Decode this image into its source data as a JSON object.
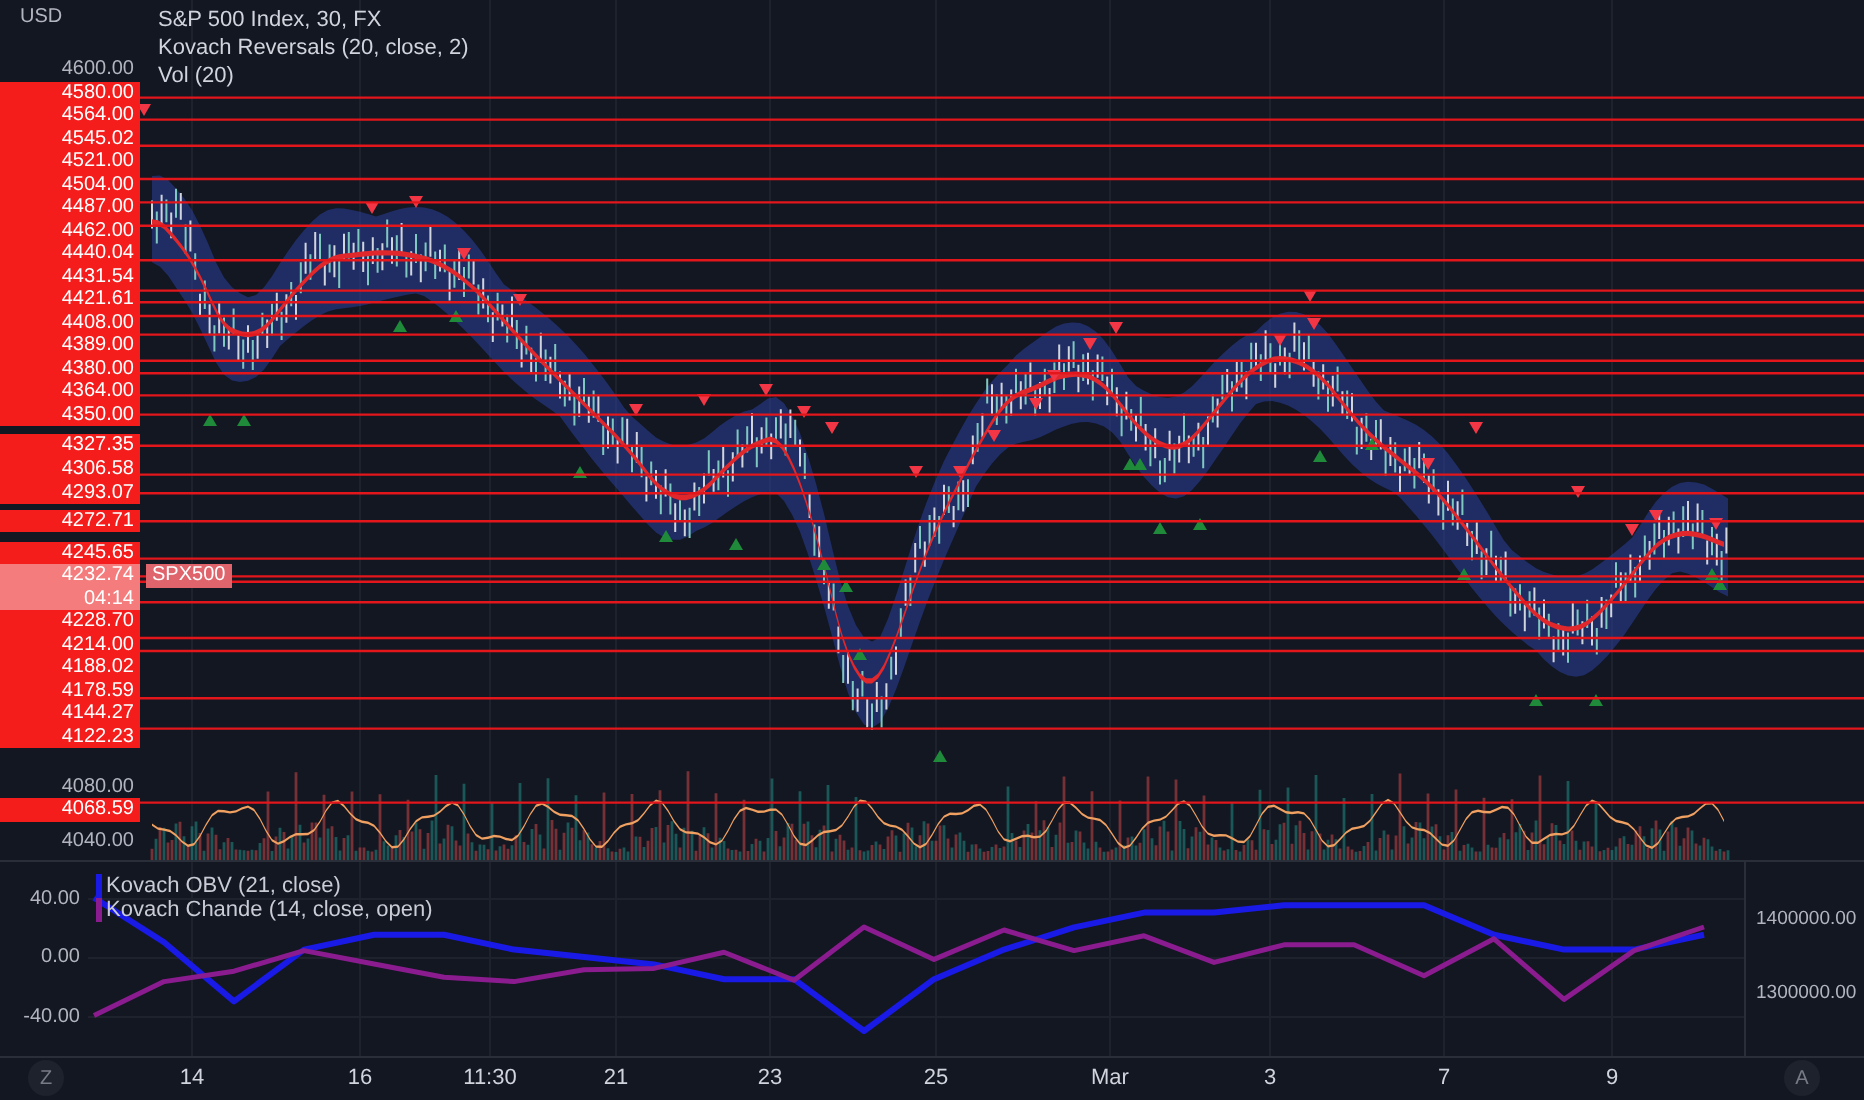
{
  "main_pane": {
    "currency": "USD",
    "legend": [
      "S&P 500 Index, 30, FX",
      "Kovach Reversals (20, close, 2)",
      "Vol (20)"
    ],
    "price_labels": [
      {
        "kind": "tick",
        "text": "4600.00"
      },
      {
        "kind": "level",
        "text": "4580.00"
      },
      {
        "kind": "level",
        "text": "4564.00"
      },
      {
        "kind": "level",
        "text": "4545.02"
      },
      {
        "kind": "level",
        "text": "4521.00"
      },
      {
        "kind": "level",
        "text": "4504.00"
      },
      {
        "kind": "level",
        "text": "4487.00"
      },
      {
        "kind": "level",
        "text": "4462.00"
      },
      {
        "kind": "level",
        "text": "4440.04"
      },
      {
        "kind": "level",
        "text": "4431.54"
      },
      {
        "kind": "level",
        "text": "4421.61"
      },
      {
        "kind": "level",
        "text": "4408.00"
      },
      {
        "kind": "level",
        "text": "4389.00"
      },
      {
        "kind": "level",
        "text": "4380.00"
      },
      {
        "kind": "level",
        "text": "4364.00"
      },
      {
        "kind": "level",
        "text": "4350.00"
      },
      {
        "kind": "level",
        "text": "4327.35"
      },
      {
        "kind": "level",
        "text": "4306.58"
      },
      {
        "kind": "level",
        "text": "4293.07"
      },
      {
        "kind": "level",
        "text": "4272.71"
      },
      {
        "kind": "level",
        "text": "4245.65"
      },
      {
        "kind": "current",
        "text": "4232.74",
        "countdown": "04:14",
        "symbol": "SPX500"
      },
      {
        "kind": "level",
        "text": "4228.70"
      },
      {
        "kind": "level",
        "text": "4214.00"
      },
      {
        "kind": "level",
        "text": "4188.02"
      },
      {
        "kind": "level",
        "text": "4178.59"
      },
      {
        "kind": "level",
        "text": "4144.27"
      },
      {
        "kind": "level",
        "text": "4122.23"
      },
      {
        "kind": "tick",
        "text": "4080.00"
      },
      {
        "kind": "level",
        "text": "4068.59"
      },
      {
        "kind": "tick",
        "text": "4040.00"
      }
    ]
  },
  "oscillator_pane": {
    "chart_data": {
      "type": "line",
      "grid": true,
      "legend": "top-left",
      "ylim": [
        -67.8,
        65.1
      ],
      "y2lim": [
        1213514,
        1478378
      ],
      "yticks": [
        {
          "value": 40,
          "label": "40.00"
        },
        {
          "value": 0,
          "label": "0.00"
        },
        {
          "value": -40,
          "label": "-40.00"
        }
      ],
      "y2ticks": [
        {
          "value": 1400000,
          "label": "1400000.00"
        },
        {
          "value": 1300000,
          "label": "1300000.00"
        }
      ],
      "series": [
        {
          "name": "Kovach OBV (21, close)",
          "color": "#1a1ae6",
          "axis": "y2",
          "values": [
            1430000,
            1370000,
            1290000,
            1360000,
            1380000,
            1380000,
            1360000,
            1350000,
            1340000,
            1320000,
            1320000,
            1250000,
            1320000,
            1360000,
            1390000,
            1410000,
            1410000,
            1420000,
            1420000,
            1420000,
            1380000,
            1360000,
            1360000,
            1380000
          ]
        },
        {
          "name": "Kovach Chande (14, close, open)",
          "color": "#8b1c8f",
          "values": [
            -39,
            -16,
            -9,
            5,
            -4,
            -13,
            -16,
            -8,
            -7,
            4,
            -15,
            21,
            -1,
            19,
            5,
            15,
            -3,
            9,
            9,
            -12,
            13,
            -28,
            5,
            21
          ]
        }
      ]
    }
  },
  "time_axis": {
    "left_button": "Z",
    "labels": [
      "14",
      "16",
      "11:30",
      "21",
      "23",
      "25",
      "Mar",
      "3",
      "7",
      "9"
    ],
    "right_button": "A"
  }
}
